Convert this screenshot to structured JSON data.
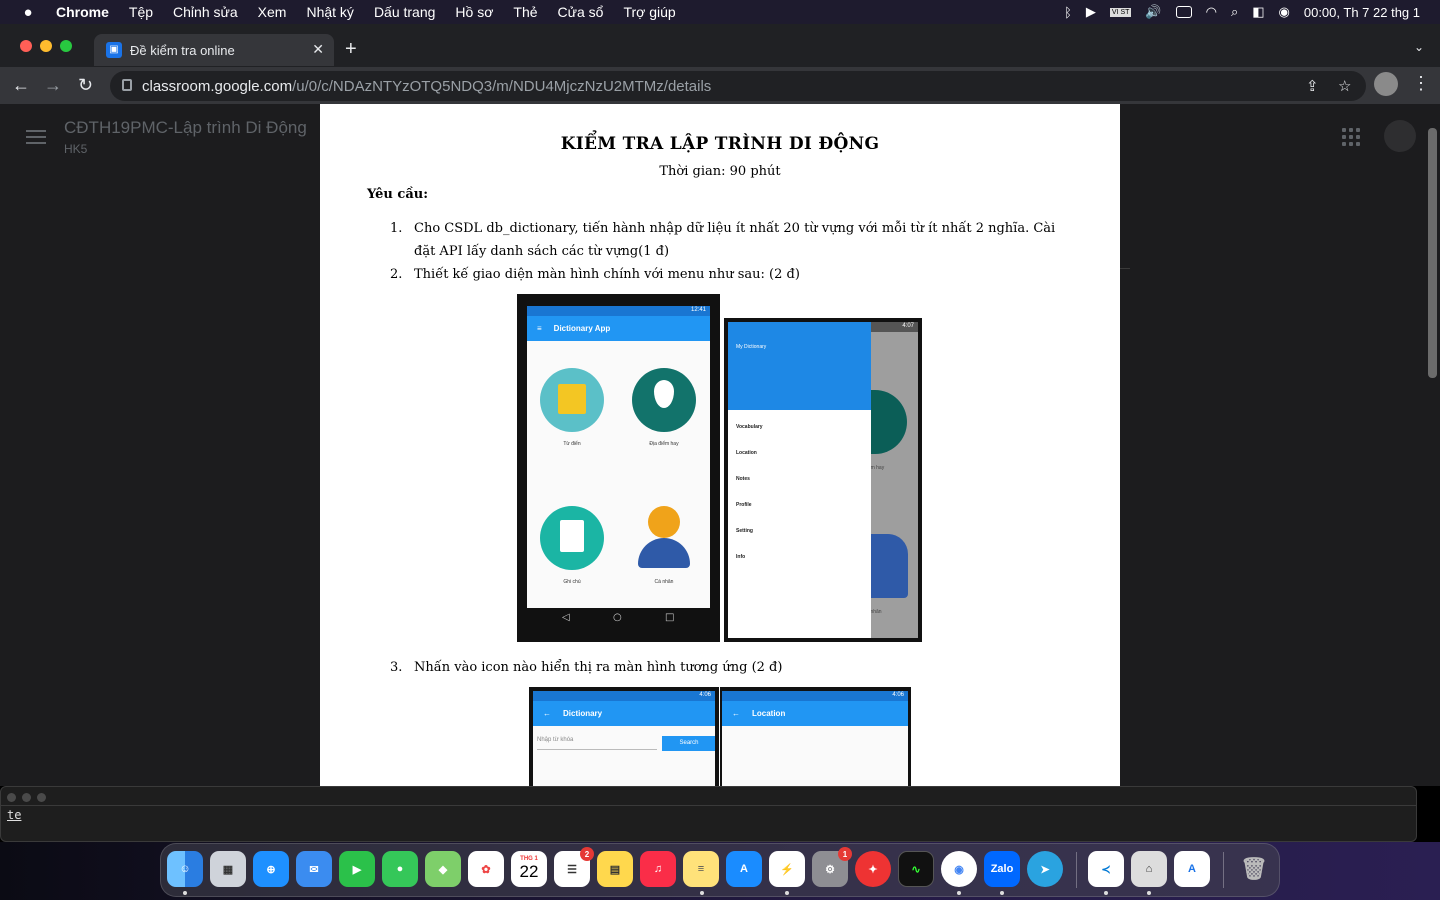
{
  "menubar": {
    "app": "Chrome",
    "items": [
      "Tệp",
      "Chỉnh sửa",
      "Xem",
      "Nhật ký",
      "Dấu trang",
      "Hồ sơ",
      "Thẻ",
      "Cửa sổ",
      "Trợ giúp"
    ],
    "clock": "00:00, Th 7 22 thg 1",
    "input_source": "VI ST"
  },
  "browser": {
    "tab_title": "Đề kiểm tra online",
    "url_host": "classroom.google.com",
    "url_path": "/u/0/c/NDAzNTYzOTQ5NDQ3/m/NDU4MjczNzU2MTMz/details"
  },
  "classroom": {
    "title": "CĐTH19PMC-Lập trình Di Động",
    "subtitle": "HK5"
  },
  "doc": {
    "title": "KIỂM TRA LẬP TRÌNH DI ĐỘNG",
    "time": "Thời gian: 90 phút",
    "req": "Yêu cầu:",
    "items": [
      {
        "num": "1.",
        "text": "Cho CSDL db_dictionary, tiến hành nhập dữ liệu ít nhất 20 từ vựng với mỗi từ ít nhất 2 nghĩa. Cài đặt API lấy danh sách các từ vựng(1 đ)"
      },
      {
        "num": "2.",
        "text": "Thiết kế giao diện màn hình chính với menu như sau: (2 đ)"
      },
      {
        "num": "3.",
        "text": "Nhấn vào icon nào hiển thị ra màn hình tương ứng (2 đ)"
      }
    ]
  },
  "phone1": {
    "time": "12:41",
    "appbar": "Dictionary App",
    "captions": [
      "Từ điển",
      "Địa điểm hay",
      "Ghi chú",
      "Cá nhân"
    ]
  },
  "phone2": {
    "time": "4:07",
    "drawer_title": "My Dictionary",
    "menu": [
      "Vocabulary",
      "Location",
      "Notes",
      "Profile",
      "Setting",
      "Info"
    ],
    "peek_caption": "ểm hay",
    "peek_caption2": "nhân"
  },
  "phone3": {
    "time": "4:06",
    "appbar": "Dictionary",
    "placeholder": "Nhập từ khóa",
    "button": "Search"
  },
  "phone4": {
    "time": "4:06",
    "appbar": "Location"
  },
  "terminal": {
    "text": "te"
  },
  "dock": {
    "calendar_month": "THG 1",
    "calendar_day": "22",
    "reminders_badge": "2",
    "settings_badge": "1",
    "zalo": "Zalo"
  },
  "colors": {
    "appbar": "#2196f3",
    "drawer_header": "#1e88e5"
  }
}
